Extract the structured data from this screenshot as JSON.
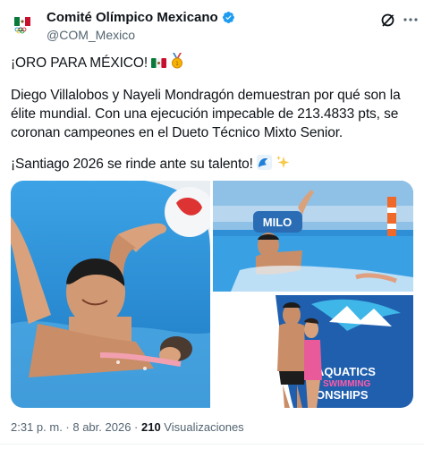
{
  "author": {
    "name": "Comité Olímpico Mexicano",
    "handle": "@COM_Mexico"
  },
  "tweet": {
    "line1": "¡ORO PARA MÉXICO!",
    "body": "Diego Villalobos y Nayeli Mondragón demuestran por qué son la élite mundial. Con una ejecución impecable de 213.4833 pts, se coronan campeones en el Dueto Técnico Mixto Senior.",
    "line3": "¡Santiago 2026 se rinde ante su talento!"
  },
  "images": {
    "photo2_sign": "MILO",
    "photo3_banner_line1": "AQUATICS",
    "photo3_banner_line2": "SWIMMING",
    "photo3_banner_line3": "ONSHIPS"
  },
  "meta": {
    "time": "2:31 p. m. · 8 abr. 2026 · ",
    "views_count": "210",
    "views_label": " Visualizaciones"
  },
  "colors": {
    "verified": "#1d9bf0",
    "pool": "#2f8fd6"
  },
  "icons": [
    "mexico-flag-avatar",
    "verified-badge-icon",
    "grok-icon",
    "more-options-icon",
    "mexico-flag-emoji",
    "gold-medal-emoji",
    "wave-emoji",
    "sparkles-emoji"
  ]
}
